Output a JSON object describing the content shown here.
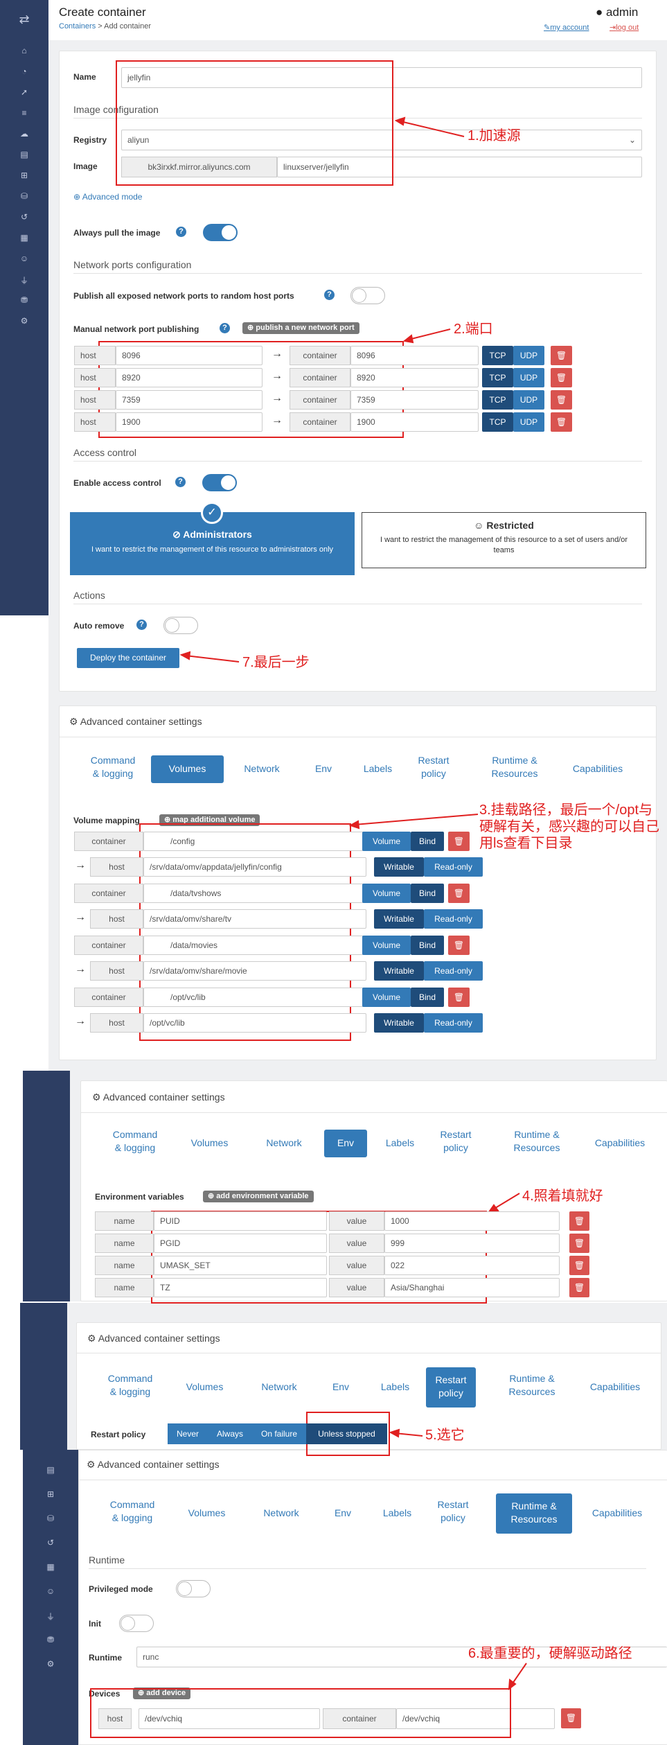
{
  "header": {
    "title": "Create container",
    "crumb_link": "Containers",
    "crumb_sep": " > ",
    "crumb_current": "Add container",
    "user": "admin",
    "my_account": "my account",
    "log_out": "log out"
  },
  "form": {
    "name_label": "Name",
    "name_value": "jellyfin",
    "image_config": "Image configuration",
    "registry_label": "Registry",
    "registry_value": "aliyun",
    "image_label": "Image",
    "image_prefix": "bk3irxkf.mirror.aliyuncs.com",
    "image_value": "linuxserver/jellyfin",
    "advanced_mode": "Advanced mode",
    "always_pull": "Always pull the image",
    "net_ports": "Network ports configuration",
    "publish_all": "Publish all exposed network ports to random host ports",
    "manual_ports": "Manual network port publishing",
    "publish_new": "publish a new network port",
    "ports": [
      {
        "host": "8096",
        "container": "8096"
      },
      {
        "host": "8920",
        "container": "8920"
      },
      {
        "host": "7359",
        "container": "7359"
      },
      {
        "host": "1900",
        "container": "1900"
      }
    ],
    "host_label": "host",
    "container_label": "container",
    "tcp": "TCP",
    "udp": "UDP",
    "access_control": "Access control",
    "enable_access": "Enable access control",
    "admins_title": "Administrators",
    "admins_desc": "I want to restrict the management of this resource to administrators only",
    "restricted_title": "Restricted",
    "restricted_desc": "I want to restrict the management of this resource to a set of users and/or teams",
    "actions": "Actions",
    "auto_remove": "Auto remove",
    "deploy": "Deploy the container"
  },
  "adv": {
    "title": "Advanced container settings",
    "tabs": {
      "cmd1": "Command",
      "cmd2": "& logging",
      "volumes": "Volumes",
      "network": "Network",
      "env": "Env",
      "labels": "Labels",
      "restart1": "Restart",
      "restart2": "policy",
      "runtime1": "Runtime &",
      "runtime2": "Resources",
      "capabilities": "Capabilities"
    },
    "volume_mapping": "Volume mapping",
    "map_volume": "map additional volume",
    "volume_btn": "Volume",
    "bind_btn": "Bind",
    "writable": "Writable",
    "readonly": "Read-only",
    "volumes": [
      {
        "container": "/config",
        "host": "/srv/data/omv/appdata/jellyfin/config"
      },
      {
        "container": "/data/tvshows",
        "host": "/srv/data/omv/share/tv"
      },
      {
        "container": "/data/movies",
        "host": "/srv/data/omv/share/movie"
      },
      {
        "container": "/opt/vc/lib",
        "host": "/opt/vc/lib"
      }
    ],
    "env_vars": "Environment variables",
    "add_env": "add environment variable",
    "name_label": "name",
    "value_label": "value",
    "env": [
      {
        "name": "PUID",
        "value": "1000"
      },
      {
        "name": "PGID",
        "value": "999"
      },
      {
        "name": "UMASK_SET",
        "value": "022"
      },
      {
        "name": "TZ",
        "value": "Asia/Shanghai"
      }
    ],
    "restart_policy": "Restart policy",
    "policies": [
      "Never",
      "Always",
      "On failure",
      "Unless stopped"
    ],
    "runtime": "Runtime",
    "privileged": "Privileged mode",
    "init": "Init",
    "runtime_label": "Runtime",
    "runtime_value": "runc",
    "devices": "Devices",
    "add_device": "add device",
    "device_host": "/dev/vchiq",
    "device_container": "/dev/vchiq"
  },
  "annotations": {
    "a1": "1.加速源",
    "a2": "2.端口",
    "a3": "3.挂载路径，最后一个/opt与硬解有关，感兴趣的可以自己用ls查看下目录",
    "a4": "4.照着填就好",
    "a5": "5.选它",
    "a6": "6.最重要的，硬解驱动路径",
    "a7": "7.最后一步"
  },
  "colors": {
    "primary": "#337ab7",
    "sidebar": "#2d3e63",
    "danger": "#d9534f",
    "annotation": "#e02020"
  }
}
